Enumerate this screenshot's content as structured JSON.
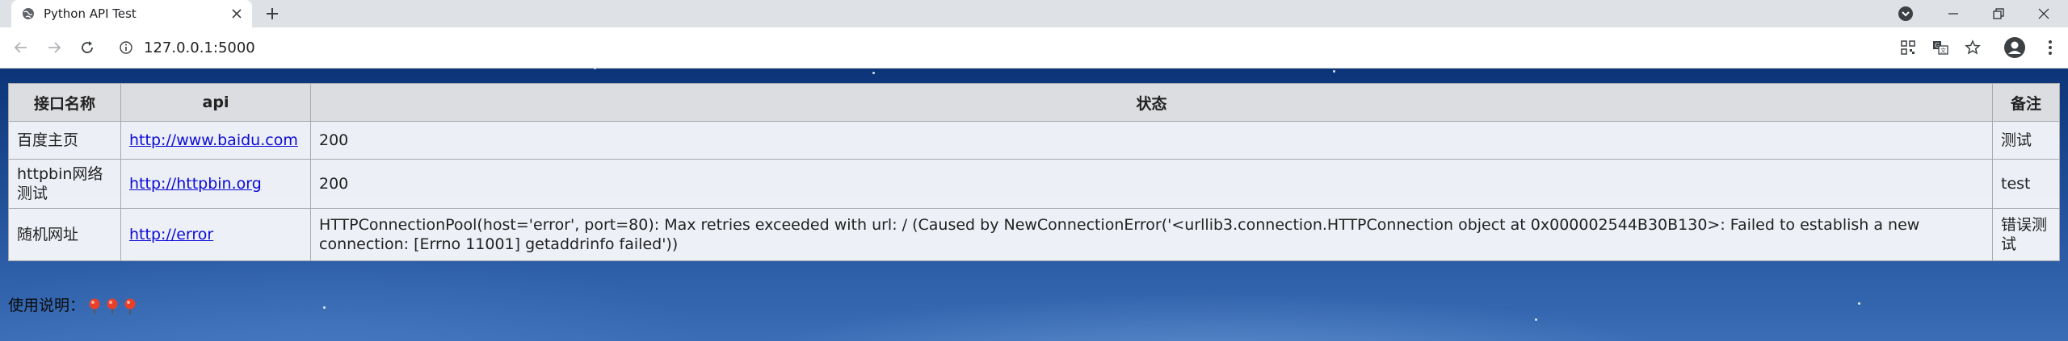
{
  "browser": {
    "tab_title": "Python API Test",
    "url": "127.0.0.1:5000"
  },
  "table": {
    "headers": [
      "接口名称",
      "api",
      "状态",
      "备注"
    ],
    "rows": [
      {
        "name": "百度主页",
        "api": "http://www.baidu.com",
        "status": "200",
        "note": "测试"
      },
      {
        "name": "httpbin网络测试",
        "api": "http://httpbin.org",
        "status": "200",
        "note": "test"
      },
      {
        "name": "随机网址",
        "api": "http://error",
        "status": "HTTPConnectionPool(host='error', port=80): Max retries exceeded with url: / (Caused by NewConnectionError('<urllib3.connection.HTTPConnection object at 0x000002544B30B130>: Failed to establish a new connection: [Errno 11001] getaddrinfo failed'))",
        "note": "错误测试"
      }
    ]
  },
  "footer": {
    "usage_label": "使用说明：",
    "pin_icons": [
      "map-pin-icon",
      "map-pin-icon",
      "map-pin-icon"
    ]
  },
  "icons": {
    "tab_favicon": "globe-icon",
    "tab_close": "close-icon",
    "new_tab": "plus-icon",
    "tab_search": "tab-search-icon",
    "back": "back-arrow-icon",
    "forward": "forward-arrow-icon",
    "reload": "reload-icon",
    "site_info": "info-icon",
    "qr": "qr-code-icon",
    "translate": "translate-icon",
    "bookmark": "star-icon",
    "profile": "profile-icon",
    "menu": "more-vertical-icon"
  },
  "colors": {
    "link": "#0b0bd6",
    "header_bg": "#dcdde1",
    "page_bg": "#1f4e97"
  }
}
